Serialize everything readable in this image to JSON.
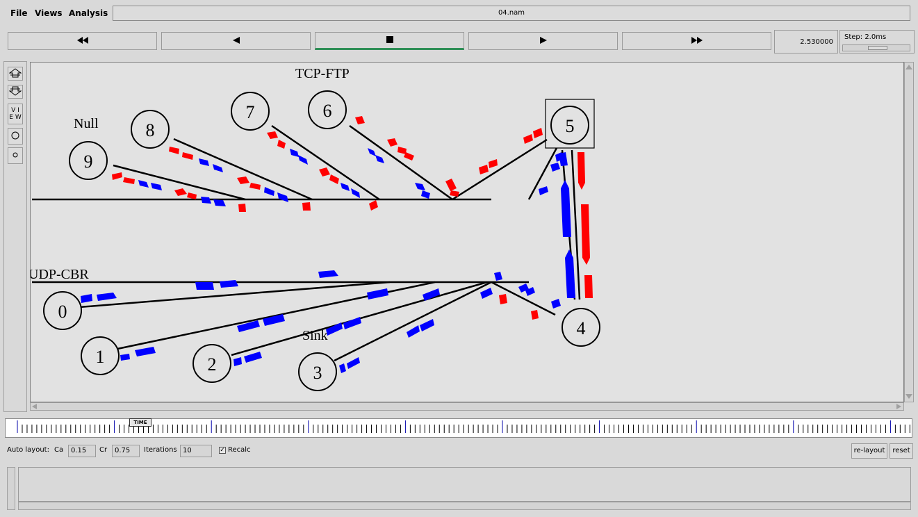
{
  "menu": {
    "file": "File",
    "views": "Views",
    "analysis": "Analysis"
  },
  "filename": "04.nam",
  "transport": {
    "rewind_icon": "fast-rewind-icon",
    "back_icon": "play-backward-icon",
    "stop_icon": "stop-icon",
    "play_icon": "play-forward-icon",
    "ff_icon": "fast-forward-icon"
  },
  "time": "2.530000",
  "step": "Step: 2.0ms",
  "sidebar": {
    "view_label_1": "V I",
    "view_label_2": "E W"
  },
  "canvas": {
    "labels": {
      "tcp": "TCP-FTP",
      "null": "Null",
      "udp": "UDP-CBR",
      "sink": "Sink"
    },
    "nodes": [
      {
        "id": "0"
      },
      {
        "id": "1"
      },
      {
        "id": "2"
      },
      {
        "id": "3"
      },
      {
        "id": "4"
      },
      {
        "id": "5"
      },
      {
        "id": "6"
      },
      {
        "id": "7"
      },
      {
        "id": "8"
      },
      {
        "id": "9"
      }
    ],
    "colors": {
      "tcp_packet": "#ff0000",
      "udp_packet": "#0000ff",
      "link": "#000000",
      "background": "#e2e2e2"
    }
  },
  "timeline": {
    "label": "TIME"
  },
  "autolayout": {
    "label": "Auto layout:",
    "ca_label": "Ca",
    "ca_value": "0.15",
    "cr_label": "Cr",
    "cr_value": "0.75",
    "iter_label": "Iterations",
    "iter_value": "10",
    "recalc_label": "Recalc",
    "recalc_checked": true,
    "relayout": "re-layout",
    "reset": "reset"
  }
}
